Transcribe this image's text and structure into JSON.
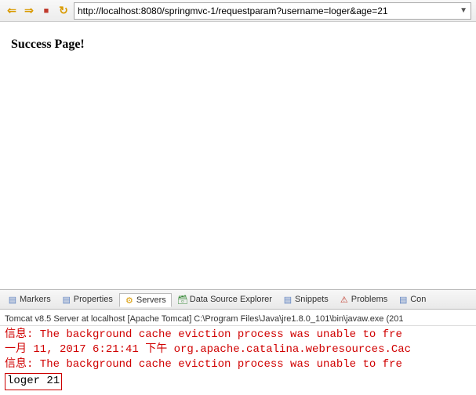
{
  "toolbar": {
    "url": "http://localhost:8080/springmvc-1/requestparam?username=loger&age=21"
  },
  "page": {
    "heading": "Success Page!"
  },
  "tabs": {
    "markers": "Markers",
    "properties": "Properties",
    "servers": "Servers",
    "dse": "Data Source Explorer",
    "snippets": "Snippets",
    "problems": "Problems",
    "console": "Con"
  },
  "consoleHeader": "Tomcat v8.5 Server at localhost [Apache Tomcat] C:\\Program Files\\Java\\jre1.8.0_101\\bin\\javaw.exe (201",
  "console": {
    "l1": "信息: The background cache eviction process was unable to fre",
    "l2": "一月 11, 2017 6:21:41 下午 org.apache.catalina.webresources.Cac",
    "l3": "信息: The background cache eviction process was unable to fre",
    "l4": "loger 21"
  }
}
